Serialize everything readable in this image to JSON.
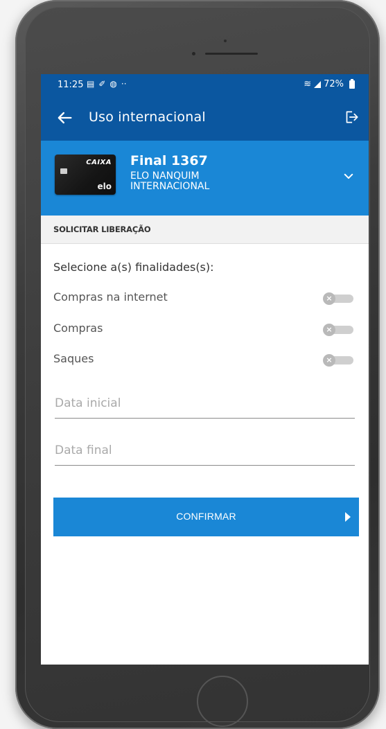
{
  "status_bar": {
    "time": "11:25",
    "battery": "72%"
  },
  "app_bar": {
    "title": "Uso internacional"
  },
  "card": {
    "brand": "CAIXA",
    "network": "elo",
    "title": "Final 1367",
    "subtitle_line1": "ELO NANQUIM",
    "subtitle_line2": "INTERNACIONAL"
  },
  "section": {
    "title": "SOLICITAR LIBERAÇÃO"
  },
  "form": {
    "select_label": "Selecione a(s) finalidades(s):",
    "toggles": [
      {
        "label": "Compras na internet",
        "checked": false
      },
      {
        "label": "Compras",
        "checked": false
      },
      {
        "label": "Saques",
        "checked": false
      }
    ],
    "date_initial_placeholder": "Data inicial",
    "date_final_placeholder": "Data final",
    "confirm_label": "CONFIRMAR"
  },
  "colors": {
    "primary_dark": "#0b57a0",
    "primary": "#1a87d6"
  },
  "icons": {
    "back": "arrow-left-icon",
    "logout": "logout-icon",
    "expand": "chevron-down-icon",
    "toggle_off": "close-icon",
    "confirm": "play-icon"
  }
}
